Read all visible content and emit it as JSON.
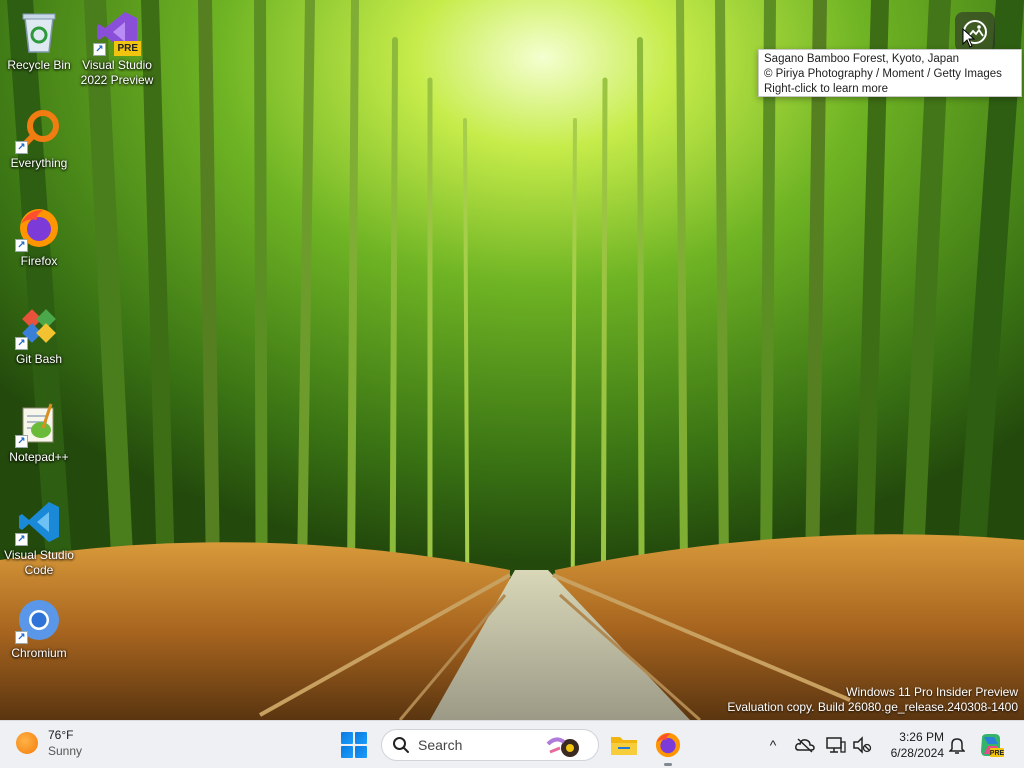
{
  "desktop": {
    "icons": [
      {
        "label": "Recycle Bin",
        "icon": "recycle-bin-icon"
      },
      {
        "label": "Visual Studio\n2022 Preview",
        "icon": "visual-studio-preview-icon",
        "badge": "PRE"
      },
      {
        "label": "Everything",
        "icon": "everything-search-icon"
      },
      {
        "label": "Firefox",
        "icon": "firefox-icon"
      },
      {
        "label": "Git Bash",
        "icon": "git-bash-icon"
      },
      {
        "label": "Notepad++",
        "icon": "notepad-plus-plus-icon"
      },
      {
        "label": "Visual Studio\nCode",
        "icon": "vscode-icon"
      },
      {
        "label": "Chromium",
        "icon": "chromium-icon"
      }
    ]
  },
  "spotlight": {
    "line1": "Sagano Bamboo Forest, Kyoto, Japan",
    "line2": "© Piriya Photography / Moment / Getty Images",
    "line3": "Right-click to learn more"
  },
  "watermark": {
    "line1": "Windows 11 Pro Insider Preview",
    "line2": "Evaluation copy. Build 26080.ge_release.240308-1400"
  },
  "taskbar": {
    "weather": {
      "temp": "76°F",
      "condition": "Sunny"
    },
    "search_placeholder": "Search",
    "pinned": [
      "file-explorer-icon",
      "firefox-icon"
    ],
    "tray": {
      "time": "3:26 PM",
      "date": "6/28/2024"
    }
  },
  "colors": {
    "taskbar_bg": "#eef0f3",
    "start_blue": "#0a7ae0",
    "bamboo_green": "#4f9a1c"
  }
}
